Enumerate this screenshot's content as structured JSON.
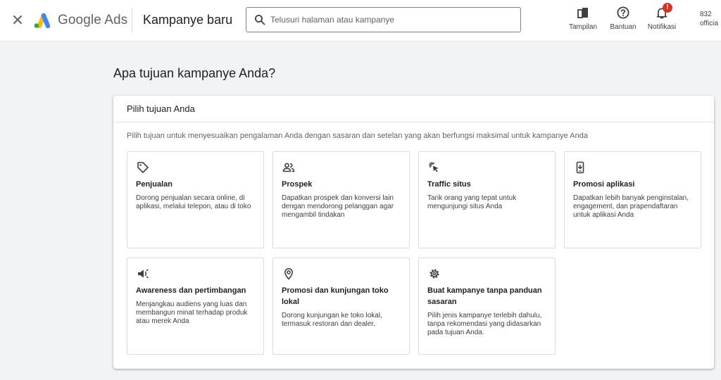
{
  "topbar": {
    "brand": "Google Ads",
    "page_title": "Kampanye baru",
    "search_placeholder": "Telusuri halaman atau kampanye",
    "tools": [
      {
        "label": "Tampilan",
        "icon": "appearance-icon"
      },
      {
        "label": "Bantuan",
        "icon": "help-icon"
      },
      {
        "label": "Notifikasi",
        "icon": "bell-icon",
        "badge": "!"
      }
    ],
    "account": {
      "line1": "832",
      "line2": "officia"
    }
  },
  "main": {
    "question": "Apa tujuan kampanye Anda?",
    "card_title": "Pilih tujuan Anda",
    "card_description": "Pilih tujuan untuk menyesuaikan pengalaman Anda dengan sasaran dan setelan yang akan berfungsi maksimal untuk kampanye Anda",
    "goals": [
      {
        "title": "Penjualan",
        "description": "Dorong penjualan secara online, di aplikasi, melalui telepon, atau di toko",
        "icon": "tag-icon"
      },
      {
        "title": "Prospek",
        "description": "Dapatkan prospek dan konversi lain dengan mendorong pelanggan agar mengambil tindakan",
        "icon": "people-icon"
      },
      {
        "title": "Traffic situs",
        "description": "Tarik orang yang tepat untuk mengunjungi situs Anda",
        "icon": "cursor-click-icon"
      },
      {
        "title": "Promosi aplikasi",
        "description": "Dapatkan lebih banyak penginstalan, engagement, dan prapendaftaran untuk aplikasi Anda",
        "icon": "phone-icon"
      },
      {
        "title": "Awareness dan pertimbangan",
        "description": "Menjangkau audiens yang luas dan membangun minat terhadap produk atau merek Anda",
        "icon": "megaphone-icon"
      },
      {
        "title": "Promosi dan kunjungan toko lokal",
        "description": "Dorong kunjungan ke toko lokal, termasuk restoran dan dealer.",
        "icon": "location-pin-icon"
      },
      {
        "title": "Buat kampanye tanpa panduan sasaran",
        "description": "Pilih jenis kampanye terlebih dahulu, tanpa rekomendasi yang didasarkan pada tujuan Anda.",
        "icon": "gear-icon"
      }
    ]
  }
}
